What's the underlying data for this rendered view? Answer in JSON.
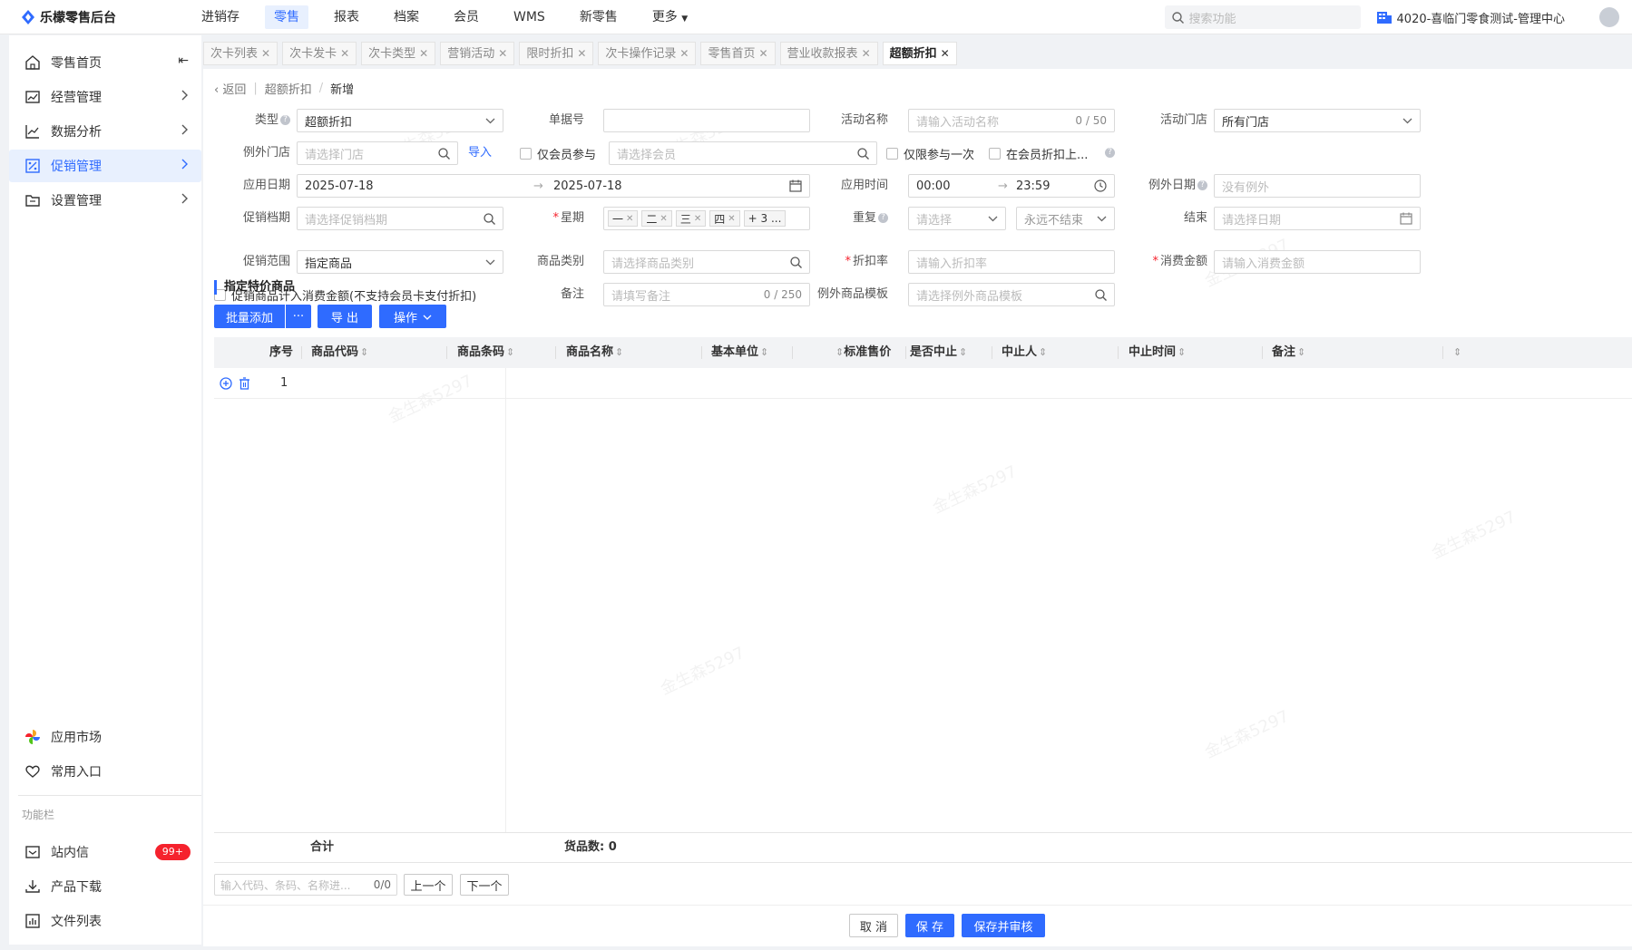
{
  "app": {
    "title": "乐檬零售后台"
  },
  "topnav": [
    "进销存",
    "零售",
    "报表",
    "档案",
    "会员",
    "WMS",
    "新零售",
    "更多"
  ],
  "topnav_active": 1,
  "search": {
    "placeholder": "搜索功能"
  },
  "org": {
    "name": "4020-喜临门零食测试-管理中心"
  },
  "sidebar": {
    "items": [
      {
        "label": "零售首页",
        "icon": "home-icon"
      },
      {
        "label": "经营管理",
        "icon": "chart-board-icon"
      },
      {
        "label": "数据分析",
        "icon": "line-chart-icon"
      },
      {
        "label": "促销管理",
        "icon": "promotion-icon"
      },
      {
        "label": "设置管理",
        "icon": "folder-icon"
      }
    ],
    "active": 3,
    "bottom": [
      {
        "label": "应用市场",
        "icon": "app-market-icon"
      },
      {
        "label": "常用入口",
        "icon": "heart-icon"
      }
    ],
    "section": "功能栏",
    "func": [
      {
        "label": "站内信",
        "icon": "mail-icon",
        "badge": "99+"
      },
      {
        "label": "产品下载",
        "icon": "download-icon"
      },
      {
        "label": "文件列表",
        "icon": "file-list-icon"
      }
    ]
  },
  "tabs": [
    "次卡列表",
    "次卡发卡",
    "次卡类型",
    "营销活动",
    "限时折扣",
    "次卡操作记录",
    "零售首页",
    "营业收款报表",
    "超额折扣"
  ],
  "tabs_active": 8,
  "breadcrumb": {
    "back": "返回",
    "parent": "超额折扣",
    "current": "新增"
  },
  "form": {
    "type_label": "类型",
    "type_value": "超额折扣",
    "order_no_label": "单据号",
    "activity_name_label": "活动名称",
    "activity_name_ph": "请输入活动名称",
    "activity_name_count": "0 / 50",
    "store_label": "活动门店",
    "store_value": "所有门店",
    "except_store_label": "例外门店",
    "except_store_ph": "请选择门店",
    "import_link": "导入",
    "member_only_label": "仅会员参与",
    "member_ph": "请选择会员",
    "once_only_label": "仅限参与一次",
    "member_discount_label": "在会员折扣上...",
    "apply_date_label": "应用日期",
    "date_start": "2025-07-18",
    "date_end": "2025-07-18",
    "apply_time_label": "应用时间",
    "time_start": "00:00",
    "time_end": "23:59",
    "except_date_label": "例外日期",
    "except_date_ph": "没有例外",
    "schedule_label": "促销档期",
    "schedule_ph": "请选择促销档期",
    "weekday_label": "星期",
    "weekday_tags": [
      "一",
      "二",
      "三",
      "四"
    ],
    "weekday_more": "+ 3 ...",
    "repeat_label": "重复",
    "repeat_ph": "请选择",
    "repeat_end": "永远不结束",
    "end_label": "结束",
    "end_ph": "请选择日期",
    "scope_label": "促销范围",
    "scope_value": "指定商品",
    "category_label": "商品类别",
    "category_ph": "请选择商品类别",
    "discount_label": "折扣率",
    "discount_ph": "请输入折扣率",
    "amount_label": "消费金额",
    "amount_ph": "请输入消费金额",
    "include_label": "促销商品计入消费金额(不支持会员卡支付折扣)",
    "remark_label": "备注",
    "remark_ph": "请填写备注",
    "remark_count": "0 / 250",
    "except_tpl_label": "例外商品模板",
    "except_tpl_ph": "请选择例外商品模板"
  },
  "section_title": "指定特价商品",
  "toolbar": {
    "batch_add": "批量添加",
    "more": "···",
    "export": "导 出",
    "ops": "操作"
  },
  "table": {
    "columns": [
      "序号",
      "商品代码",
      "商品条码",
      "商品名称",
      "基本单位",
      "标准售价",
      "是否中止",
      "中止人",
      "中止时间",
      "备注"
    ],
    "rows": [
      {
        "index": "1"
      }
    ],
    "footer_total": "合计",
    "footer_count": "货品数: 0"
  },
  "finder": {
    "placeholder": "输入代码、条码、名称进...",
    "count": "0/0",
    "prev": "上一个",
    "next": "下一个"
  },
  "actions": {
    "cancel": "取 消",
    "save": "保 存",
    "save_audit": "保存并审核"
  },
  "watermark": "金生森5297",
  "colors": {
    "primary": "#2f6bff",
    "danger": "#f5222d"
  }
}
